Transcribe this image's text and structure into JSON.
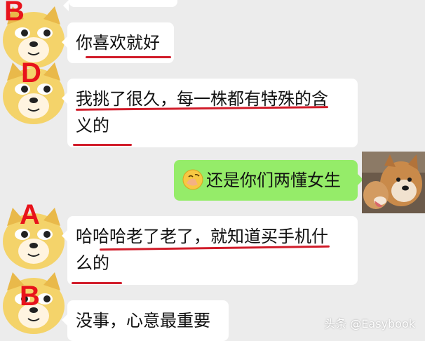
{
  "messages": [
    {
      "speaker": "B",
      "text": "你喜欢就好",
      "side": "left"
    },
    {
      "speaker": "D",
      "line1": "我挑了很久，每一株都有特殊的含",
      "line2": "义的",
      "side": "left"
    },
    {
      "emoji": "facepalm-emoji",
      "text": "还是你们两懂女生",
      "side": "right"
    },
    {
      "speaker": "A",
      "line1": "哈哈哈老了老了，就知道买手机什",
      "line2": "么的",
      "side": "left"
    },
    {
      "speaker": "B",
      "text": "没事，心意最重要",
      "side": "left"
    }
  ],
  "watermark": "头条 @Easybook",
  "colors": {
    "bubble_self": "#95ec69",
    "bubble_other": "#ffffff",
    "annotation": "#e8131b",
    "underline": "#d11c2a",
    "background": "#ececec"
  }
}
